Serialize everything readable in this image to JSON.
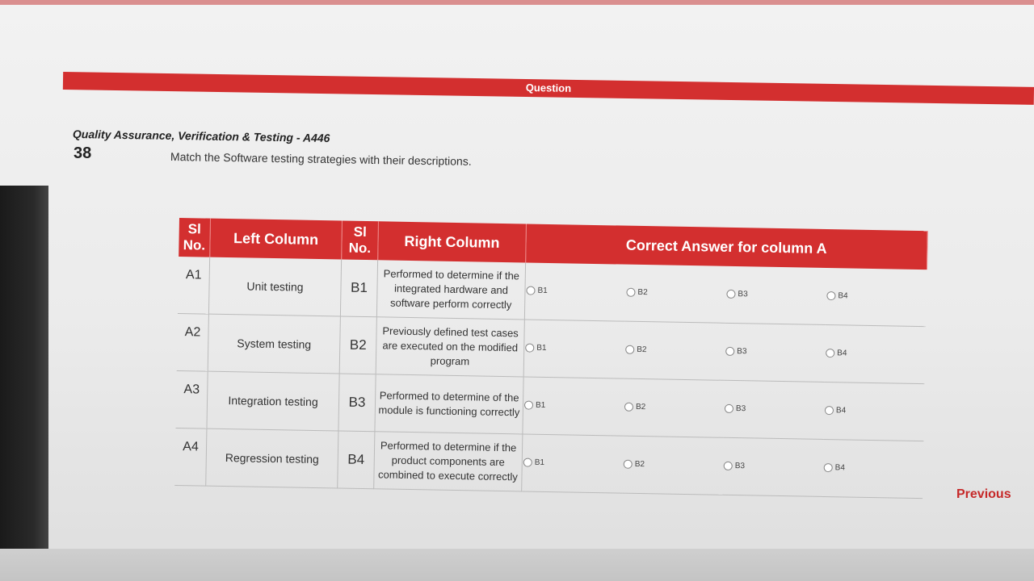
{
  "header": {
    "bar_label": "Question"
  },
  "course_title": "Quality Assurance, Verification & Testing - A446",
  "question": {
    "number": "38",
    "text": "Match the Software testing strategies with their descriptions."
  },
  "table": {
    "headers": {
      "sl_no_left": "Sl No.",
      "left_column": "Left Column",
      "sl_no_right": "Sl No.",
      "right_column": "Right Column",
      "answer": "Correct Answer for column A"
    },
    "rows": [
      {
        "sl": "A1",
        "left": "Unit testing",
        "sl2": "B1",
        "right": "Performed to determine if the integrated hardware and software perform correctly"
      },
      {
        "sl": "A2",
        "left": "System testing",
        "sl2": "B2",
        "right": "Previously defined test cases are executed on the modified program"
      },
      {
        "sl": "A3",
        "left": "Integration testing",
        "sl2": "B3",
        "right": "Performed to determine of the module is functioning correctly"
      },
      {
        "sl": "A4",
        "left": "Regression testing",
        "sl2": "B4",
        "right": "Performed to determine if the product components are combined to execute correctly"
      }
    ],
    "options": [
      "B1",
      "B2",
      "B3",
      "B4"
    ]
  },
  "nav": {
    "previous": "Previous"
  },
  "colors": {
    "accent": "#d32f2f"
  }
}
